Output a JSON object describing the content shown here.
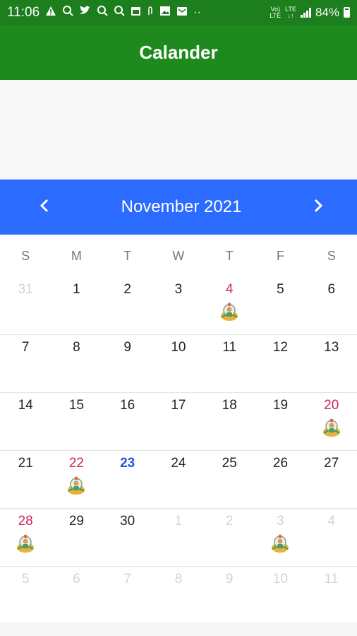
{
  "status_bar": {
    "time": "11:06",
    "battery": "84%",
    "network_top": "Vo)",
    "network_bottom": "LTE",
    "lte_top": "LTE",
    "lte_bottom": "↓↑"
  },
  "app_bar": {
    "title": "Calander"
  },
  "calendar": {
    "month_label": "November  2021",
    "prev_icon": "chevron-left-icon",
    "next_icon": "chevron-right-icon",
    "weekdays": [
      "S",
      "M",
      "T",
      "W",
      "T",
      "F",
      "S"
    ],
    "weeks": [
      [
        "31",
        "1",
        "2",
        "3",
        "4",
        "5",
        "6"
      ],
      [
        "7",
        "8",
        "9",
        "10",
        "11",
        "12",
        "13"
      ],
      [
        "14",
        "15",
        "16",
        "17",
        "18",
        "19",
        "20"
      ],
      [
        "21",
        "22",
        "23",
        "24",
        "25",
        "26",
        "27"
      ],
      [
        "28",
        "29",
        "30",
        "1",
        "2",
        "3",
        "4"
      ],
      [
        "5",
        "6",
        "7",
        "8",
        "9",
        "10",
        "11"
      ]
    ],
    "colors": {
      "holiday": "#d0245e",
      "today": "#1f57e8",
      "header": "#2b6bff",
      "app_bar": "#1e8a1e"
    }
  }
}
